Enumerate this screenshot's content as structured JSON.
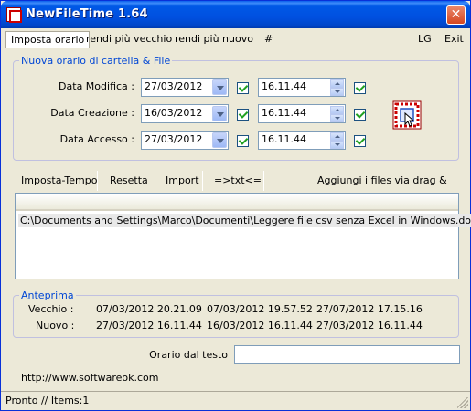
{
  "window": {
    "title": "NewFileTime 1.64"
  },
  "menu": {
    "items": [
      "Imposta orario",
      "rendi più vecchio",
      "rendi più nuovo",
      "#"
    ],
    "right": [
      "LG",
      "Exit"
    ]
  },
  "group_new": {
    "title": "Nuova orario di cartella & File",
    "rows": [
      {
        "label": "Data Modifica :",
        "date": "27/03/2012",
        "time": "16.11.44"
      },
      {
        "label": "Data Creazione :",
        "date": "16/03/2012",
        "time": "16.11.44"
      },
      {
        "label": "Data Accesso :",
        "date": "27/03/2012",
        "time": "16.11.44"
      }
    ]
  },
  "toolbar": {
    "set_time": "Imposta-Tempo",
    "reset": "Resetta",
    "import": "Import",
    "txt": "=>txt<=",
    "add_files": "Aggiungi i files via drag & drop"
  },
  "filelist": {
    "items": [
      "C:\\Documents and Settings\\Marco\\Documenti\\Leggere file csv senza Excel in Windows.doc"
    ]
  },
  "preview": {
    "title": "Anteprima",
    "old_label": "Vecchio :",
    "new_label": "Nuovo :",
    "old_values": [
      "07/03/2012 20.21.09",
      "07/03/2012 19.57.52",
      "27/07/2012 17.15.16"
    ],
    "new_values": [
      "27/03/2012 16.11.44",
      "16/03/2012 16.11.44",
      "27/03/2012 16.11.44"
    ]
  },
  "text_time": {
    "label": "Orario dal testo",
    "value": ""
  },
  "website": "http://www.softwareok.com",
  "status": {
    "text": "Pronto // Items:1"
  },
  "colors": {
    "title_bar": "#0058E6",
    "group_title": "#0046D5",
    "check": "#21A121",
    "close": "#D54720"
  }
}
